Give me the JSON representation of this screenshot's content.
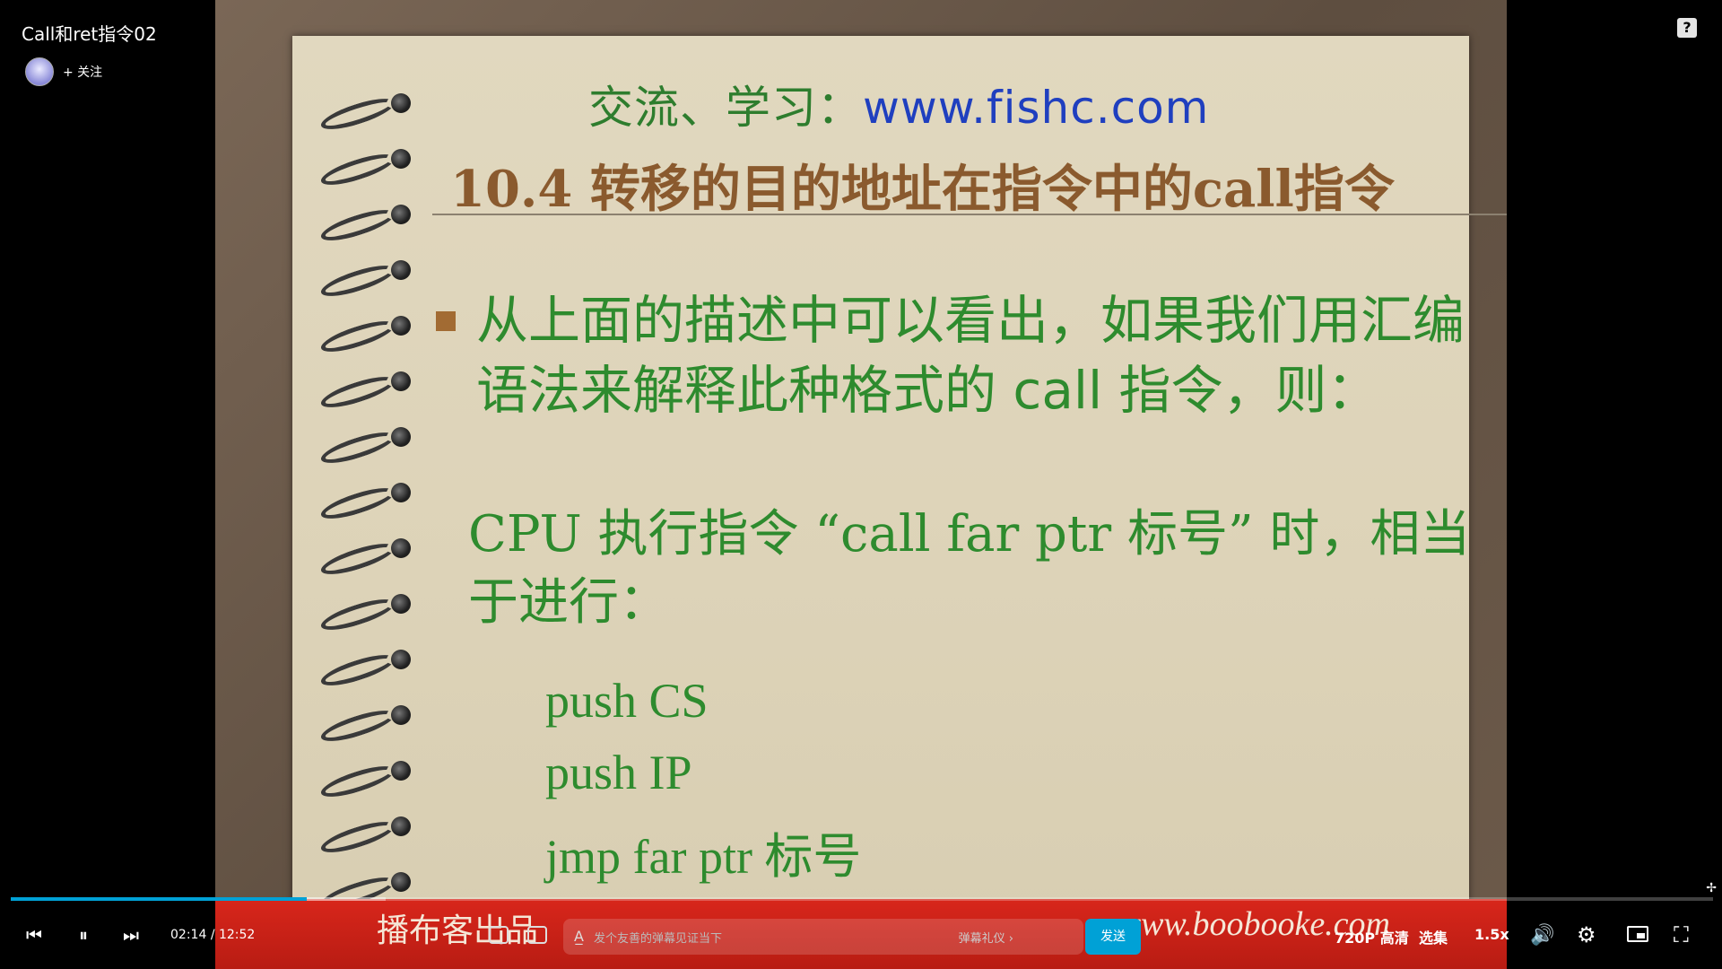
{
  "video": {
    "title": "Call和ret指令02",
    "follow_label": "+ 关注",
    "help_label": "?"
  },
  "slide": {
    "site_prefix": "交流、学习：",
    "site_url": "www.fishc.com",
    "title": "10.4 转移的目的地址在指令中的call指令",
    "bullet": "从上面的描述中可以看出，如果我们用汇编语法来解释此种格式的 call 指令，则：",
    "cpu_text": "CPU 执行指令 “call far ptr 标号” 时，相当于进行：",
    "code_lines": [
      "push CS",
      "push IP",
      "jmp far ptr  标号"
    ],
    "banner_left": "播布客出品",
    "banner_right": "www.boobooke.com"
  },
  "player": {
    "current_time": "02:14",
    "separator": "/",
    "duration": "12:52",
    "progress_percent": 17.4,
    "danmaku_placeholder": "发个友善的弹幕见证当下",
    "danmaku_etiquette": "弹幕礼仪 ›",
    "send_label": "发送",
    "quality": "720P 高清",
    "episodes": "选集",
    "speed": "1.5x",
    "accent_color": "#00a1d6"
  },
  "icons": {
    "prev": "prev-icon",
    "pause": "pause-icon",
    "next": "next-icon",
    "volume": "volume-icon",
    "settings": "gear-icon",
    "pip": "pip-icon",
    "fullscreen": "fullscreen-icon"
  }
}
